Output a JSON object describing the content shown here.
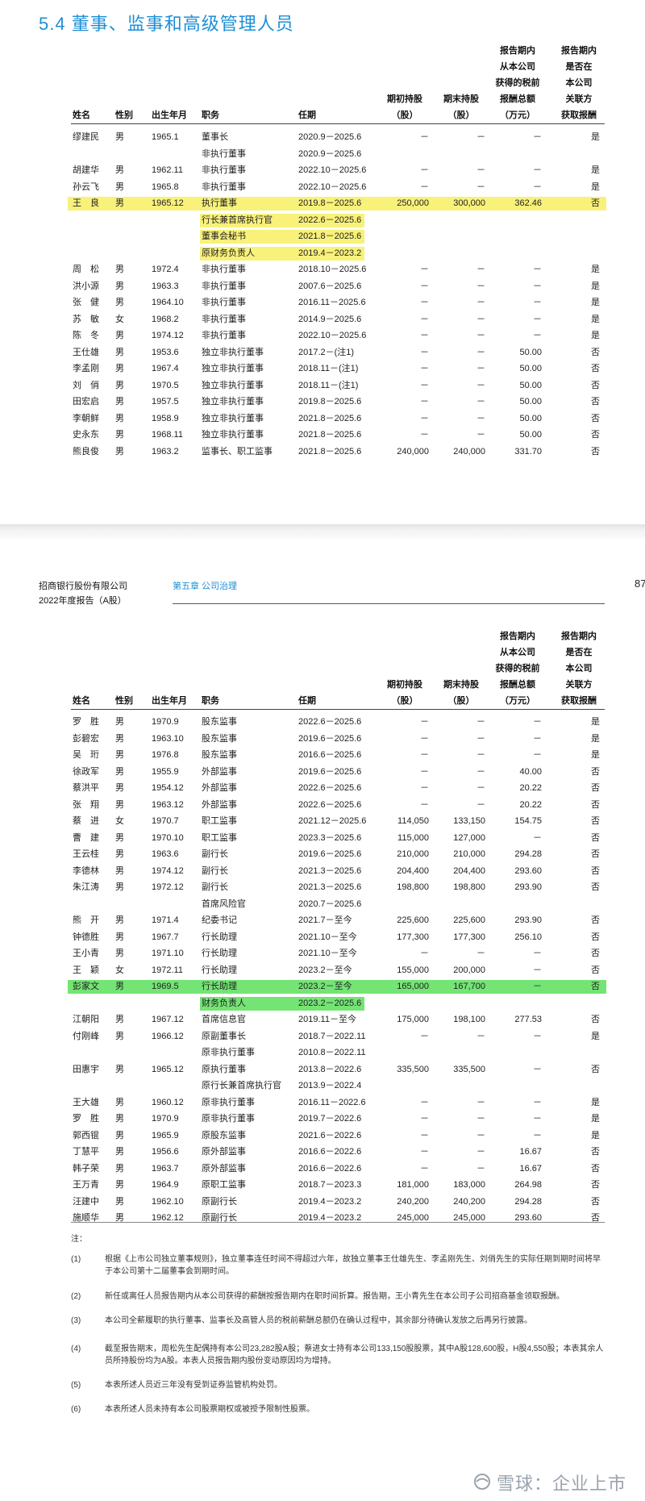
{
  "section_title": "5.4 董事、监事和高级管理人员",
  "header": {
    "company_line1": "招商银行股份有限公司",
    "company_line2": "2022年度报告（A股）",
    "chapter": "第五章 公司治理",
    "page_number": "87"
  },
  "columns": {
    "name": "姓名",
    "gender": "性别",
    "birth": "出生年月",
    "position": "职务",
    "term": "任期",
    "start_shares": [
      "期初持股",
      "（股）"
    ],
    "end_shares": [
      "期末持股",
      "（股）"
    ],
    "pay": [
      "报告期内",
      "从本公司",
      "获得的税前",
      "报酬总额",
      "（万元）"
    ],
    "related": [
      "报告期内",
      "是否在",
      "本公司",
      "关联方",
      "获取报酬"
    ]
  },
  "table1": [
    [
      "缪建民",
      "男",
      "1965.1",
      "董事长",
      "2020.9－2025.6",
      "－",
      "－",
      "－",
      "是"
    ],
    [
      "",
      "",
      "",
      "非执行董事",
      "2020.9－2025.6",
      "",
      "",
      "",
      ""
    ],
    [
      "胡建华",
      "男",
      "1962.11",
      "非执行董事",
      "2022.10－2025.6",
      "－",
      "－",
      "－",
      "是"
    ],
    [
      "孙云飞",
      "男",
      "1965.8",
      "非执行董事",
      "2022.10－2025.6",
      "－",
      "－",
      "－",
      "是"
    ],
    [
      "王　良",
      "男",
      "1965.12",
      "执行董事",
      "2019.8－2025.6",
      "250,000",
      "300,000",
      "362.46",
      "否"
    ],
    [
      "",
      "",
      "",
      "行长兼首席执行官",
      "2022.6－2025.6",
      "",
      "",
      "",
      ""
    ],
    [
      "",
      "",
      "",
      "董事会秘书",
      "2021.8－2025.6",
      "",
      "",
      "",
      ""
    ],
    [
      "",
      "",
      "",
      "原财务负责人",
      "2019.4－2023.2",
      "",
      "",
      "",
      ""
    ],
    [
      "周　松",
      "男",
      "1972.4",
      "非执行董事",
      "2018.10－2025.6",
      "－",
      "－",
      "－",
      "是"
    ],
    [
      "洪小源",
      "男",
      "1963.3",
      "非执行董事",
      "2007.6－2025.6",
      "－",
      "－",
      "－",
      "是"
    ],
    [
      "张　健",
      "男",
      "1964.10",
      "非执行董事",
      "2016.11－2025.6",
      "－",
      "－",
      "－",
      "是"
    ],
    [
      "苏　敏",
      "女",
      "1968.2",
      "非执行董事",
      "2014.9－2025.6",
      "－",
      "－",
      "－",
      "是"
    ],
    [
      "陈　冬",
      "男",
      "1974.12",
      "非执行董事",
      "2022.10－2025.6",
      "－",
      "－",
      "－",
      "是"
    ],
    [
      "王仕雄",
      "男",
      "1953.6",
      "独立非执行董事",
      "2017.2－(注1)",
      "－",
      "－",
      "50.00",
      "否"
    ],
    [
      "李孟刚",
      "男",
      "1967.4",
      "独立非执行董事",
      "2018.11－(注1)",
      "－",
      "－",
      "50.00",
      "否"
    ],
    [
      "刘　俏",
      "男",
      "1970.5",
      "独立非执行董事",
      "2018.11－(注1)",
      "－",
      "－",
      "50.00",
      "否"
    ],
    [
      "田宏启",
      "男",
      "1957.5",
      "独立非执行董事",
      "2019.8－2025.6",
      "－",
      "－",
      "50.00",
      "否"
    ],
    [
      "李朝鲜",
      "男",
      "1958.9",
      "独立非执行董事",
      "2021.8－2025.6",
      "－",
      "－",
      "50.00",
      "否"
    ],
    [
      "史永东",
      "男",
      "1968.11",
      "独立非执行董事",
      "2021.8－2025.6",
      "－",
      "－",
      "50.00",
      "否"
    ],
    [
      "熊良俊",
      "男",
      "1963.2",
      "监事长、职工监事",
      "2021.8－2025.6",
      "240,000",
      "240,000",
      "331.70",
      "否"
    ]
  ],
  "table2": [
    [
      "罗　胜",
      "男",
      "1970.9",
      "股东监事",
      "2022.6－2025.6",
      "－",
      "－",
      "－",
      "是"
    ],
    [
      "彭碧宏",
      "男",
      "1963.10",
      "股东监事",
      "2019.6－2025.6",
      "－",
      "－",
      "－",
      "是"
    ],
    [
      "吴　珩",
      "男",
      "1976.8",
      "股东监事",
      "2016.6－2025.6",
      "－",
      "－",
      "－",
      "是"
    ],
    [
      "徐政军",
      "男",
      "1955.9",
      "外部监事",
      "2019.6－2025.6",
      "－",
      "－",
      "40.00",
      "否"
    ],
    [
      "蔡洪平",
      "男",
      "1954.12",
      "外部监事",
      "2022.6－2025.6",
      "－",
      "－",
      "20.22",
      "否"
    ],
    [
      "张　翔",
      "男",
      "1963.12",
      "外部监事",
      "2022.6－2025.6",
      "－",
      "－",
      "20.22",
      "否"
    ],
    [
      "蔡　进",
      "女",
      "1970.7",
      "职工监事",
      "2021.12－2025.6",
      "114,050",
      "133,150",
      "154.75",
      "否"
    ],
    [
      "曹　建",
      "男",
      "1970.10",
      "职工监事",
      "2023.3－2025.6",
      "115,000",
      "127,000",
      "－",
      "否"
    ],
    [
      "王云桂",
      "男",
      "1963.6",
      "副行长",
      "2019.6－2025.6",
      "210,000",
      "210,000",
      "294.28",
      "否"
    ],
    [
      "李德林",
      "男",
      "1974.12",
      "副行长",
      "2021.3－2025.6",
      "204,400",
      "204,400",
      "293.60",
      "否"
    ],
    [
      "朱江涛",
      "男",
      "1972.12",
      "副行长",
      "2021.3－2025.6",
      "198,800",
      "198,800",
      "293.90",
      "否"
    ],
    [
      "",
      "",
      "",
      "首席风险官",
      "2020.7－2025.6",
      "",
      "",
      "",
      ""
    ],
    [
      "熊　开",
      "男",
      "1971.4",
      "纪委书记",
      "2021.7－至今",
      "225,600",
      "225,600",
      "293.90",
      "否"
    ],
    [
      "钟德胜",
      "男",
      "1967.7",
      "行长助理",
      "2021.10－至今",
      "177,300",
      "177,300",
      "256.10",
      "否"
    ],
    [
      "王小青",
      "男",
      "1971.10",
      "行长助理",
      "2021.10－至今",
      "－",
      "－",
      "－",
      "否"
    ],
    [
      "王　颖",
      "女",
      "1972.11",
      "行长助理",
      "2023.2－至今",
      "155,000",
      "200,000",
      "－",
      "否"
    ],
    [
      "彭家文",
      "男",
      "1969.5",
      "行长助理",
      "2023.2－至今",
      "165,000",
      "167,700",
      "－",
      "否"
    ],
    [
      "",
      "",
      "",
      "财务负责人",
      "2023.2－2025.6",
      "",
      "",
      "",
      ""
    ],
    [
      "江朝阳",
      "男",
      "1967.12",
      "首席信息官",
      "2019.11－至今",
      "175,000",
      "198,100",
      "277.53",
      "否"
    ],
    [
      "付刚峰",
      "男",
      "1966.12",
      "原副董事长",
      "2018.7－2022.11",
      "－",
      "－",
      "－",
      "是"
    ],
    [
      "",
      "",
      "",
      "原非执行董事",
      "2010.8－2022.11",
      "",
      "",
      "",
      ""
    ],
    [
      "田惠宇",
      "男",
      "1965.12",
      "原执行董事",
      "2013.8－2022.6",
      "335,500",
      "335,500",
      "－",
      "否"
    ],
    [
      "",
      "",
      "",
      "原行长兼首席执行官",
      "2013.9－2022.4",
      "",
      "",
      "",
      ""
    ],
    [
      "王大雄",
      "男",
      "1960.12",
      "原非执行董事",
      "2016.11－2022.6",
      "－",
      "－",
      "－",
      "是"
    ],
    [
      "罗　胜",
      "男",
      "1970.9",
      "原非执行董事",
      "2019.7－2022.6",
      "－",
      "－",
      "－",
      "是"
    ],
    [
      "郭西锟",
      "男",
      "1965.9",
      "原股东监事",
      "2021.6－2022.6",
      "－",
      "－",
      "－",
      "是"
    ],
    [
      "丁慧平",
      "男",
      "1956.6",
      "原外部监事",
      "2016.6－2022.6",
      "－",
      "－",
      "16.67",
      "否"
    ],
    [
      "韩子荣",
      "男",
      "1963.7",
      "原外部监事",
      "2016.6－2022.6",
      "－",
      "－",
      "16.67",
      "否"
    ],
    [
      "王万青",
      "男",
      "1964.9",
      "原职工监事",
      "2018.7－2023.3",
      "181,000",
      "183,000",
      "264.98",
      "否"
    ],
    [
      "汪建中",
      "男",
      "1962.10",
      "原副行长",
      "2019.4－2023.2",
      "240,200",
      "240,200",
      "294.28",
      "否"
    ],
    [
      "施顺华",
      "男",
      "1962.12",
      "原副行长",
      "2019.4－2023.2",
      "245,000",
      "245,000",
      "293.60",
      "否"
    ]
  ],
  "notes_label": "注：",
  "notes": [
    {
      "num": "(1)",
      "text": "根据《上市公司独立董事规则》，独立董事连任时间不得超过六年，故独立董事王仕雄先生、李孟刚先生、刘俏先生的实际任期到期时间将早于本公司第十二届董事会到期时间。"
    },
    {
      "num": "(2)",
      "text": "新任或离任人员报告期内从本公司获得的薪酬按报告期内在职时间折算。报告期，王小青先生在本公司子公司招商基金领取报酬。"
    },
    {
      "num": "(3)",
      "text": "本公司全薪履职的执行董事、监事长及高管人员的税前薪酬总额仍在确认过程中，其余部分待确认发放之后再另行披露。"
    },
    {
      "num": "(4)",
      "text": "截至报告期末，周松先生配偶持有本公司23,282股A股；蔡进女士持有本公司133,150股股票，其中A股128,600股，H股4,550股；本表其余人员所持股份均为A股。本表人员报告期内股份变动原因均为增持。"
    },
    {
      "num": "(5)",
      "text": "本表所述人员近三年没有受到证券监管机构处罚。"
    },
    {
      "num": "(6)",
      "text": "本表所述人员未持有本公司股票期权或被授予限制性股票。"
    }
  ],
  "watermark": "雪球：企业上市",
  "colors": {
    "accent": "#1e8fd6",
    "highlight_yellow": "#f8f17a",
    "highlight_green": "#74e474"
  },
  "highlights": {
    "table1": [
      4,
      5,
      6,
      7
    ],
    "table2": [
      16,
      17
    ]
  }
}
